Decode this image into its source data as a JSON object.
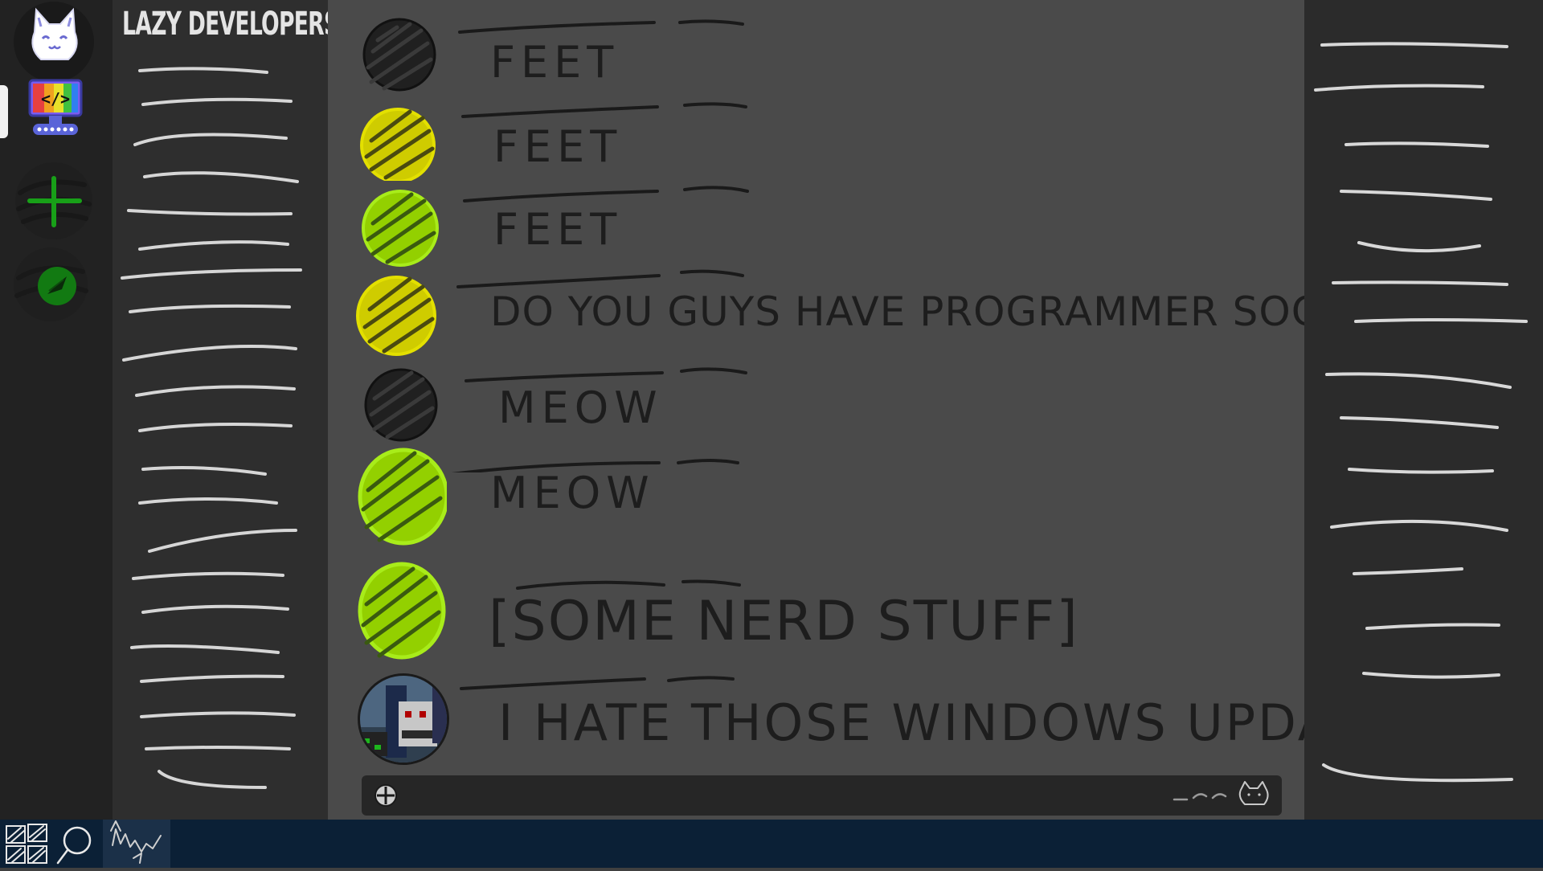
{
  "server_rail": {
    "servers": [
      {
        "name": "home",
        "icon": "cat-face-icon"
      },
      {
        "name": "dev-server",
        "icon": "code-monitor-icon",
        "active": true
      },
      {
        "name": "add-server",
        "icon": "plus-icon"
      },
      {
        "name": "discover",
        "icon": "compass-icon"
      }
    ]
  },
  "channel_sidebar": {
    "server_name": "LAZY DEVELOPERS"
  },
  "messages": [
    {
      "avatar_color": "#202020",
      "text": "FEET"
    },
    {
      "avatar_color": "#e3e000",
      "text": "FEET"
    },
    {
      "avatar_color": "#a8ec1a",
      "text": "FEET"
    },
    {
      "avatar_color": "#e3e000",
      "text": "DO YOU GUYS HAVE PROGRAMMER SOCKS???"
    },
    {
      "avatar_color": "#202020",
      "text": "MEOW"
    },
    {
      "avatar_color": "#a8ec1a",
      "text": "MEOW"
    },
    {
      "avatar_color": "#a8ec1a",
      "text": "[SOME NERD STUFF]"
    },
    {
      "avatar_color": "pixel-art",
      "text": "I HATE THOSE WINDOWS UPDATES"
    }
  ],
  "composer": {
    "placeholder": "",
    "left_icon": "attach-icon",
    "right_icon": "cat-emoji-icon"
  },
  "taskbar": {
    "icons": [
      "windows-start-icon",
      "search-icon",
      "app-icon"
    ]
  },
  "colors": {
    "rail_bg": "#222222",
    "channel_bg": "#2e2e2e",
    "chat_bg": "#4a4a4a",
    "members_bg": "#2b2b2b",
    "taskbar_bg": "#0b2036",
    "accent_yellow": "#e3e000",
    "accent_green": "#a8ec1a"
  }
}
